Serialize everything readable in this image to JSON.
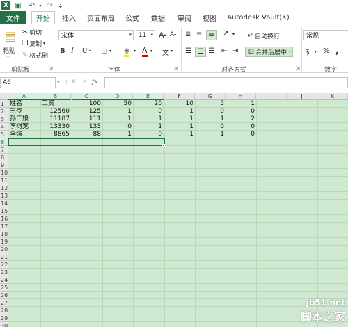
{
  "titlebar": {
    "logo": "X",
    "undo": "↶",
    "redo": "↷",
    "more": "⇣"
  },
  "tabs": [
    "文件",
    "开始",
    "插入",
    "页面布局",
    "公式",
    "数据",
    "审阅",
    "视图",
    "Autodesk Vault(K)"
  ],
  "ribbon": {
    "clipboard": {
      "paste": "粘贴",
      "cut": "剪切",
      "copy": "复制",
      "format_painter": "格式刷",
      "label": "剪贴板"
    },
    "font": {
      "name": "宋体",
      "size": "11",
      "grow": "A",
      "shrink": "A",
      "bold": "B",
      "italic": "I",
      "underline": "U",
      "label": "字体"
    },
    "alignment": {
      "wrap": "自动换行",
      "merge": "合并后居中",
      "label": "对齐方式"
    },
    "number": {
      "format": "常规",
      "percent": "%",
      "comma": ",",
      "label": "数字"
    }
  },
  "formula_bar": {
    "name_box": "A6",
    "cancel": "✕",
    "enter": "✓",
    "fx": "fx",
    "content": ""
  },
  "grid": {
    "columns": [
      "A",
      "B",
      "C",
      "D",
      "E",
      "F",
      "G",
      "H",
      "I",
      "J",
      "K"
    ],
    "rows": [
      "1",
      "2",
      "3",
      "4",
      "5",
      "6",
      "7",
      "8",
      "9",
      "10",
      "11",
      "12",
      "13",
      "14",
      "15",
      "16",
      "17",
      "18",
      "19",
      "20",
      "21",
      "22",
      "23",
      "24",
      "25",
      "26",
      "27",
      "28",
      "29",
      "30"
    ],
    "data": [
      [
        "姓名",
        "工资",
        "100",
        "50",
        "20",
        "10",
        "5",
        "1"
      ],
      [
        "王岑",
        "12560",
        "125",
        "1",
        "0",
        "1",
        "0",
        "0"
      ],
      [
        "孙二娘",
        "11187",
        "111",
        "1",
        "1",
        "1",
        "1",
        "2"
      ],
      [
        "李树宽",
        "13330",
        "133",
        "0",
        "1",
        "1",
        "0",
        "0"
      ],
      [
        "李强",
        "8865",
        "88",
        "1",
        "0",
        "1",
        "1",
        "0"
      ]
    ]
  },
  "watermark": {
    "site": "jb51.net",
    "brand": "脚本之家"
  }
}
